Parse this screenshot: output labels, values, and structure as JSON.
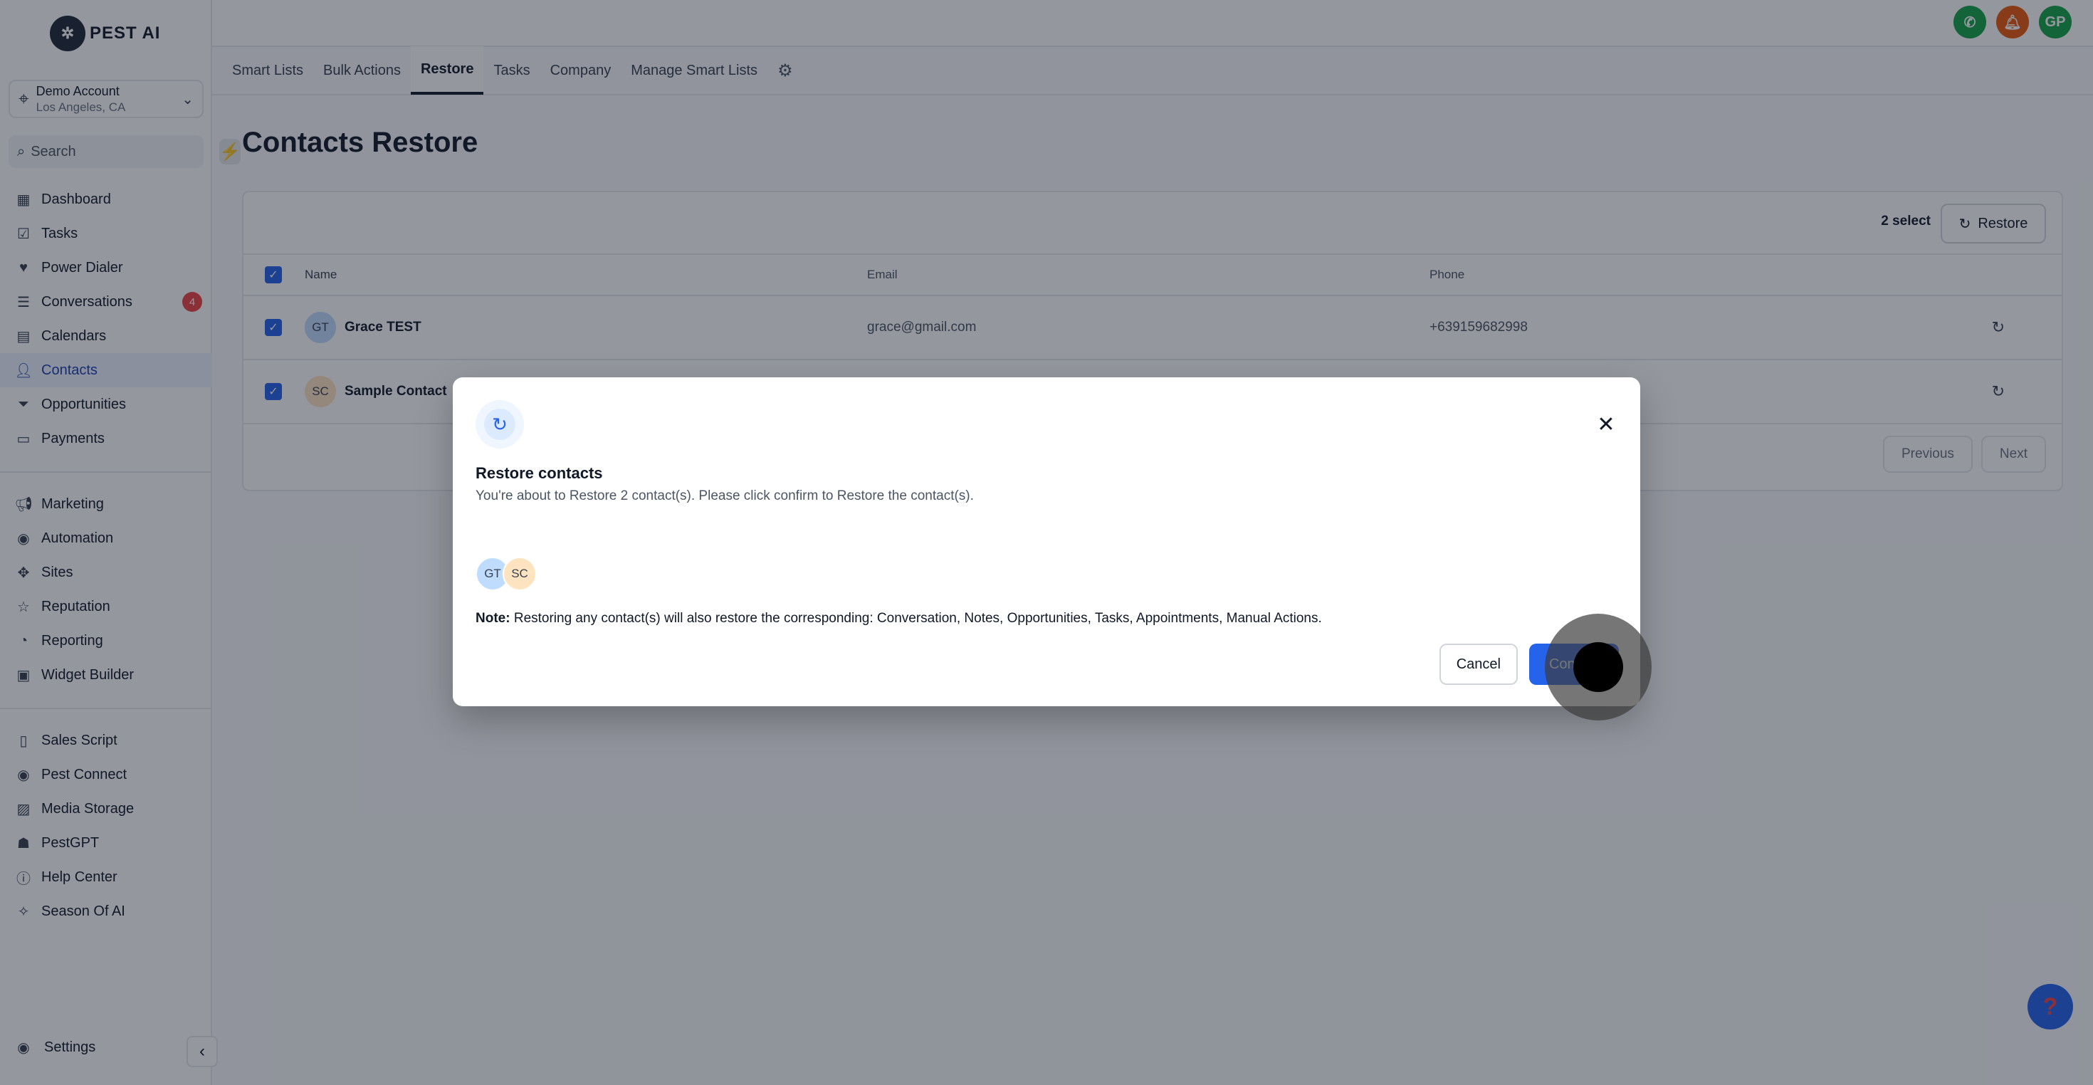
{
  "brand": {
    "name": "PEST AI"
  },
  "account": {
    "name": "Demo Account",
    "location": "Los Angeles, CA"
  },
  "search": {
    "placeholder": "Search"
  },
  "nav_primary": [
    {
      "label": "Dashboard",
      "icon": "dashboard-icon"
    },
    {
      "label": "Tasks",
      "icon": "tasks-icon"
    },
    {
      "label": "Power Dialer",
      "icon": "dialer-icon"
    },
    {
      "label": "Conversations",
      "icon": "chat-icon",
      "badge": "4"
    },
    {
      "label": "Calendars",
      "icon": "calendar-icon"
    },
    {
      "label": "Contacts",
      "icon": "person-icon",
      "active": true
    },
    {
      "label": "Opportunities",
      "icon": "filter-icon"
    },
    {
      "label": "Payments",
      "icon": "payments-icon"
    }
  ],
  "nav_secondary": [
    {
      "label": "Marketing",
      "icon": "megaphone-icon"
    },
    {
      "label": "Automation",
      "icon": "automation-icon"
    },
    {
      "label": "Sites",
      "icon": "sites-icon"
    },
    {
      "label": "Reputation",
      "icon": "star-icon"
    },
    {
      "label": "Reporting",
      "icon": "chart-icon"
    },
    {
      "label": "Widget Builder",
      "icon": "widget-icon"
    }
  ],
  "nav_tertiary": [
    {
      "label": "Sales Script",
      "icon": "script-icon"
    },
    {
      "label": "Pest Connect",
      "icon": "connect-icon"
    },
    {
      "label": "Media Storage",
      "icon": "image-icon"
    },
    {
      "label": "PestGPT",
      "icon": "robot-icon"
    },
    {
      "label": "Help Center",
      "icon": "question-icon"
    },
    {
      "label": "Season Of AI",
      "icon": "sparkle-icon"
    }
  ],
  "settings_label": "Settings",
  "top_avatar": "GP",
  "tabs": [
    {
      "label": "Smart Lists"
    },
    {
      "label": "Bulk Actions"
    },
    {
      "label": "Restore",
      "active": true
    },
    {
      "label": "Tasks"
    },
    {
      "label": "Company"
    },
    {
      "label": "Manage Smart Lists"
    }
  ],
  "page_title": "Contacts Restore",
  "table": {
    "select_count": "2 select",
    "restore_label": "Restore",
    "columns": {
      "name": "Name",
      "email": "Email",
      "phone": "Phone"
    },
    "rows": [
      {
        "initials": "GT",
        "name": "Grace TEST",
        "email": "grace@gmail.com",
        "phone": "+639159682998",
        "avatar_color": "#bfdbfe"
      },
      {
        "initials": "SC",
        "name": "Sample Contact",
        "email": "",
        "phone": "",
        "avatar_color": "#fde3c0"
      }
    ],
    "previous_label": "Previous",
    "next_label": "Next"
  },
  "modal": {
    "title": "Restore contacts",
    "description": "You're about to Restore 2 contact(s). Please click confirm to Restore the contact(s).",
    "avatars": [
      "GT",
      "SC"
    ],
    "note_label": "Note:",
    "note_text": " Restoring any contact(s) will also restore the corresponding: Conversation, Notes, Opportunities, Tasks, Appointments, Manual Actions.",
    "cancel_label": "Cancel",
    "confirm_label": "Confirm"
  },
  "colors": {
    "accent": "#2563eb",
    "badge": "#ef4444",
    "phone": "#16a34a",
    "bell": "#ea580c",
    "avatar_top": "#16a34a"
  }
}
